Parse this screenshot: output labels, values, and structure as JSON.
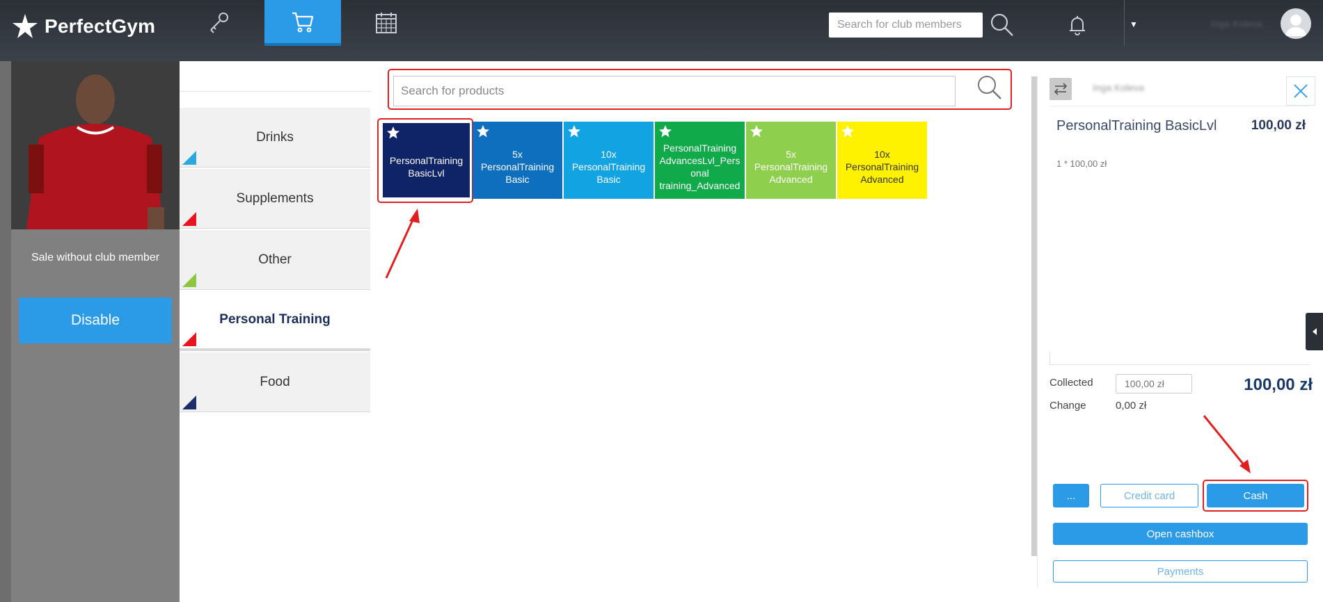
{
  "app": {
    "logo_text": "PerfectGym"
  },
  "header": {
    "nav": [
      {
        "name": "keys",
        "icon": "key-icon"
      },
      {
        "name": "shop",
        "icon": "cart-icon",
        "active": true
      },
      {
        "name": "calendar",
        "icon": "calendar-icon"
      }
    ],
    "search_placeholder": "Search for club members",
    "user_name": "Inga Koleva"
  },
  "member_panel": {
    "sale_label": "Sale without club member",
    "disable_label": "Disable"
  },
  "categories": [
    {
      "label": "Drinks",
      "color": "#29a9e0"
    },
    {
      "label": "Supplements",
      "color": "#e8141e"
    },
    {
      "label": "Other",
      "color": "#8dc63f"
    },
    {
      "label": "Personal Training",
      "color": "#e8141e",
      "active": true
    },
    {
      "label": "Food",
      "color": "#1b2e6b"
    }
  ],
  "products": {
    "search_placeholder": "Search for products",
    "items": [
      {
        "label": "PersonalTraining BasicLvl",
        "color": "#0e2467"
      },
      {
        "label": "5x PersonalTraining Basic",
        "color": "#0f6fbf"
      },
      {
        "label": "10x PersonalTraining Basic",
        "color": "#12a3e3"
      },
      {
        "label": "PersonalTraining AdvancesLvl_Personal training_Advanced",
        "color": "#10aa4a"
      },
      {
        "label": "5x PersonalTraining Advanced",
        "color": "#8fcf4e"
      },
      {
        "label": "10x PersonalTraining Advanced",
        "color": "#fff200"
      }
    ]
  },
  "cart": {
    "client_name": "Inga Koleva",
    "item_name": "PersonalTraining BasicLvl",
    "item_price": "100,00 zł",
    "item_qty": "1 * 100,00 zł",
    "collected_label": "Collected",
    "collected_value": "100,00 zł",
    "change_label": "Change",
    "change_value": "0,00 zł",
    "total": "100,00 zł",
    "more_label": "...",
    "credit_card_label": "Credit card",
    "cash_label": "Cash",
    "open_cashbox_label": "Open cashbox",
    "payments_label": "Payments"
  }
}
